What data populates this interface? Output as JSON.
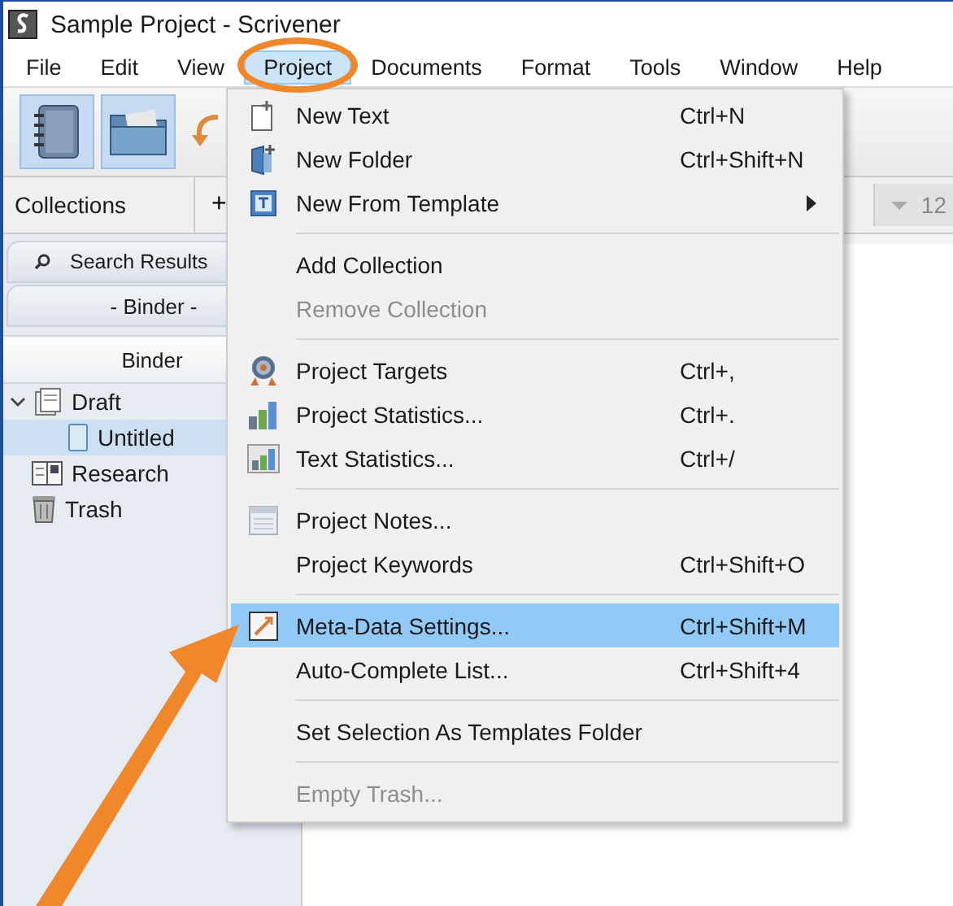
{
  "window": {
    "title": "Sample Project - Scrivener"
  },
  "menu_bar": [
    {
      "label": "File",
      "selected": false
    },
    {
      "label": "Edit",
      "selected": false
    },
    {
      "label": "View",
      "selected": false
    },
    {
      "label": "Project",
      "selected": true
    },
    {
      "label": "Documents",
      "selected": false
    },
    {
      "label": "Format",
      "selected": false
    },
    {
      "label": "Tools",
      "selected": false
    },
    {
      "label": "Window",
      "selected": false
    },
    {
      "label": "Help",
      "selected": false
    }
  ],
  "format_bar": {
    "collections_label": "Collections",
    "add_button": "+",
    "font_size": "12"
  },
  "binder": {
    "tabs": [
      {
        "label": "Search Results",
        "selected": false
      },
      {
        "label": "- Binder -",
        "selected": false
      }
    ],
    "header": "Binder",
    "items": [
      {
        "label": "Draft",
        "expanded": true,
        "selected": false,
        "children": [
          {
            "label": "Untitled",
            "selected": true
          }
        ]
      },
      {
        "label": "Research",
        "selected": false
      },
      {
        "label": "Trash",
        "selected": false
      }
    ]
  },
  "menu": {
    "items": [
      {
        "kind": "item",
        "label": "New Text",
        "shortcut": "Ctrl+N",
        "selected": false,
        "disabled": false,
        "submenu": false
      },
      {
        "kind": "item",
        "label": "New Folder",
        "shortcut": "Ctrl+Shift+N",
        "selected": false,
        "disabled": false,
        "submenu": false
      },
      {
        "kind": "item",
        "label": "New From Template",
        "selected": false,
        "disabled": false,
        "submenu": true
      },
      {
        "kind": "separator"
      },
      {
        "kind": "item",
        "label": "Add Collection",
        "selected": false,
        "disabled": false,
        "submenu": false
      },
      {
        "kind": "item",
        "label": "Remove Collection",
        "selected": false,
        "disabled": true,
        "submenu": false
      },
      {
        "kind": "separator"
      },
      {
        "kind": "item",
        "label": "Project Targets",
        "shortcut": "Ctrl+,",
        "selected": false,
        "disabled": false,
        "submenu": false
      },
      {
        "kind": "item",
        "label": "Project Statistics...",
        "shortcut": "Ctrl+.",
        "selected": false,
        "disabled": false,
        "submenu": false
      },
      {
        "kind": "item",
        "label": "Text Statistics...",
        "shortcut": "Ctrl+/",
        "selected": false,
        "disabled": false,
        "submenu": false
      },
      {
        "kind": "separator"
      },
      {
        "kind": "item",
        "label": "Project Notes...",
        "selected": false,
        "disabled": false,
        "submenu": false
      },
      {
        "kind": "item",
        "label": "Project Keywords",
        "shortcut": "Ctrl+Shift+O",
        "selected": false,
        "disabled": false,
        "submenu": false
      },
      {
        "kind": "separator"
      },
      {
        "kind": "item",
        "label": "Meta-Data Settings...",
        "shortcut": "Ctrl+Shift+M",
        "selected": true,
        "disabled": false,
        "submenu": false
      },
      {
        "kind": "item",
        "label": "Auto-Complete List...",
        "shortcut": "Ctrl+Shift+4",
        "selected": false,
        "disabled": false,
        "submenu": false
      },
      {
        "kind": "separator"
      },
      {
        "kind": "item",
        "label": "Set Selection As Templates Folder",
        "selected": false,
        "disabled": false,
        "submenu": false
      },
      {
        "kind": "separator"
      },
      {
        "kind": "item",
        "label": "Empty Trash...",
        "selected": false,
        "disabled": true,
        "submenu": false
      }
    ]
  }
}
